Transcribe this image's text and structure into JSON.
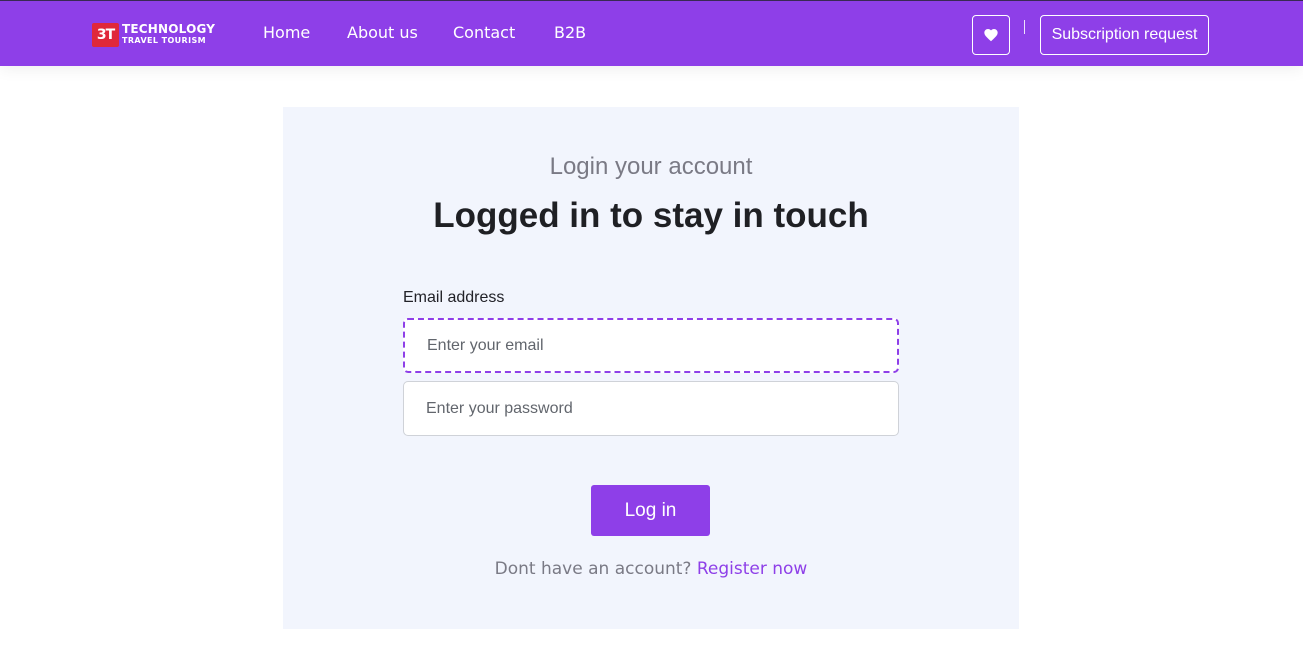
{
  "brand": {
    "logo_mark": "3T",
    "line1": "TECHNOLOGY",
    "line2": "TRAVEL TOURISM"
  },
  "nav": {
    "links": [
      "Home",
      "About us",
      "Contact",
      "B2B"
    ]
  },
  "header_actions": {
    "favorites_icon": "heart-icon",
    "subscription_label": "Subscription request"
  },
  "login": {
    "subtitle": "Login your account",
    "title": "Logged in to stay in touch",
    "email_label": "Email address",
    "email_placeholder": "Enter your email",
    "password_placeholder": "Enter your password",
    "submit_label": "Log in",
    "register_prompt": "Dont have an account?",
    "register_link": "Register now"
  },
  "colors": {
    "brand_purple": "#8e3fe8",
    "card_background": "#f2f5fd",
    "logo_red": "#e0283a"
  }
}
